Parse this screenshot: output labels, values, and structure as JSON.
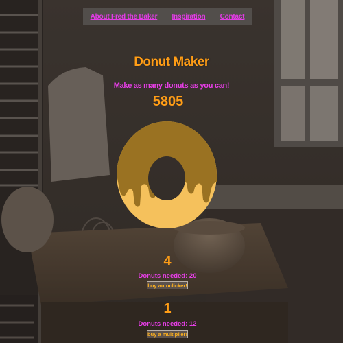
{
  "nav": {
    "items": [
      {
        "label": "About Fred the Baker"
      },
      {
        "label": "Inspiration"
      },
      {
        "label": "Contact"
      }
    ]
  },
  "game": {
    "title": "Donut Maker",
    "subtitle": "Make as many donuts as you can!",
    "donut_count": "5805"
  },
  "autoclicker": {
    "count": "4",
    "needed_label": "Donuts needed: 20",
    "button_label": "buy autoclicker!"
  },
  "multiplier": {
    "count": "1",
    "needed_label": "Donuts needed: 12",
    "button_label": "buy a multiplier!"
  },
  "colors": {
    "accent_orange": "#ff9d16",
    "accent_magenta": "#e83ee8",
    "donut_dough": "#f5c15c",
    "donut_glaze": "#9a7222"
  },
  "icons": {
    "donut": "donut-icon"
  }
}
